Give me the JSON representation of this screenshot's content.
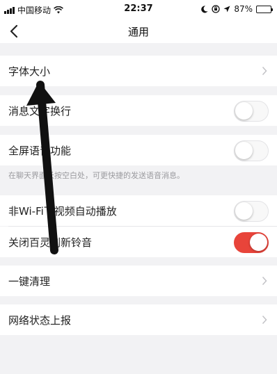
{
  "status_bar": {
    "carrier": "中国移动",
    "time": "22:37",
    "battery_percent": "87%",
    "battery_level": 0.87,
    "icons": [
      "signal-icon",
      "wifi-icon",
      "moon-icon",
      "lock-rotation-icon",
      "location-icon",
      "battery-icon"
    ]
  },
  "nav": {
    "back_icon": "chevron-left-icon",
    "title": "通用"
  },
  "settings": {
    "font_size": {
      "label": "字体大小",
      "icon": "chevron-right-icon"
    },
    "message_enter_newline": {
      "label": "消息文字换行",
      "on": false
    },
    "fullscreen_voice": {
      "label": "全屏语音功能",
      "on": false,
      "hint": "在聊天界面长按空白处，可更快捷的发送语音消息。"
    },
    "non_wifi_autoplay": {
      "label": "非Wi-Fi下视频自动播放",
      "on": false
    },
    "disable_refresh_sound": {
      "label": "关闭百灵刷新铃音",
      "on": true
    },
    "one_click_clean": {
      "label": "一键清理",
      "icon": "chevron-right-icon"
    },
    "network_report": {
      "label": "网络状态上报",
      "icon": "chevron-right-icon"
    }
  },
  "colors": {
    "accent": "#e8443a",
    "background": "#f2f2f4",
    "annotation_arrow": "#111111"
  }
}
